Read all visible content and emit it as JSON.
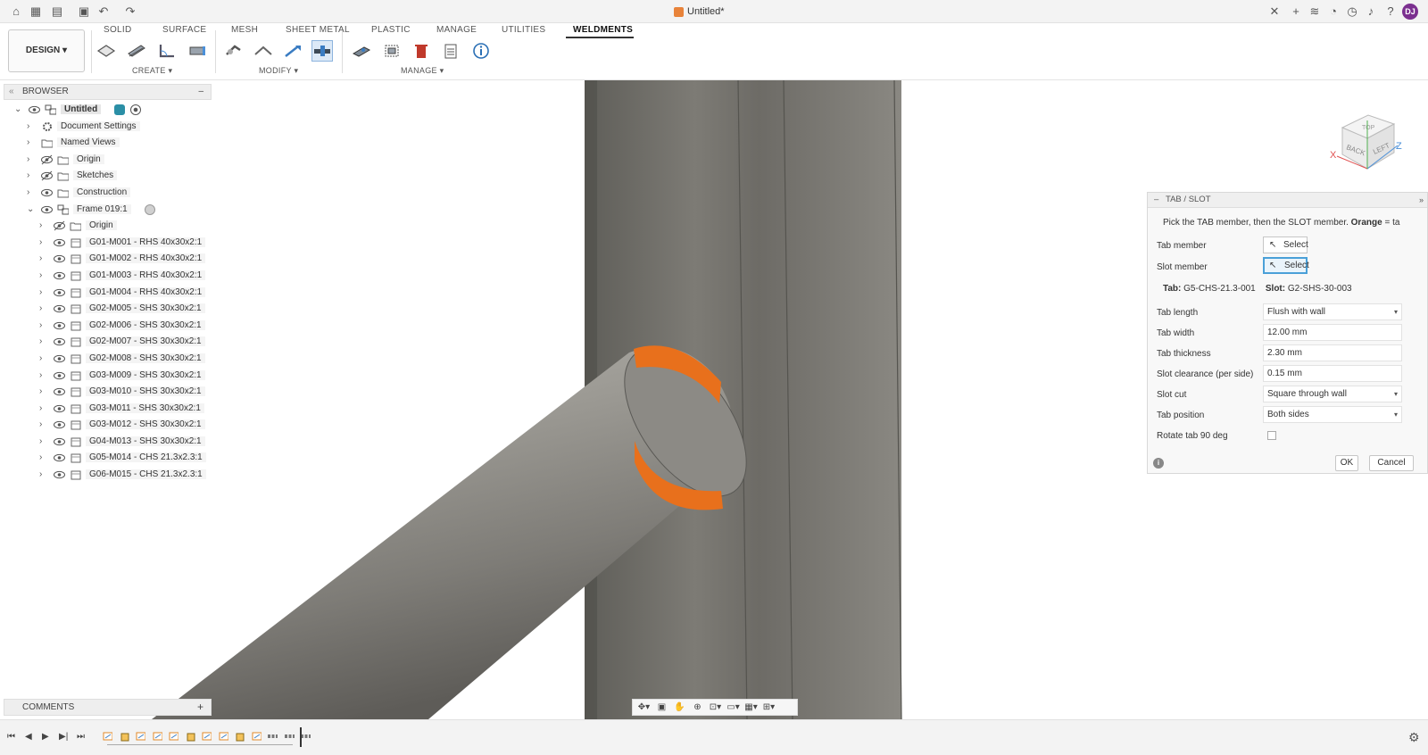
{
  "window": {
    "title": "Untitled*",
    "user_initials": "DJ"
  },
  "workspace_button": "DESIGN",
  "tabs": [
    {
      "label": "SOLID"
    },
    {
      "label": "SURFACE"
    },
    {
      "label": "MESH"
    },
    {
      "label": "SHEET METAL"
    },
    {
      "label": "PLASTIC"
    },
    {
      "label": "MANAGE"
    },
    {
      "label": "UTILITIES"
    },
    {
      "label": "WELDMENTS"
    }
  ],
  "active_tab": "WELDMENTS",
  "tool_groups": {
    "create": "CREATE",
    "modify": "MODIFY",
    "manage": "MANAGE"
  },
  "browser": {
    "title": "BROWSER",
    "root": "Untitled",
    "items": [
      {
        "label": "Document Settings"
      },
      {
        "label": "Named Views"
      },
      {
        "label": "Origin"
      },
      {
        "label": "Sketches"
      },
      {
        "label": "Construction"
      },
      {
        "label": "Frame 019:1"
      },
      {
        "label": "Origin"
      },
      {
        "label": "G01-M001 - RHS 40x30x2:1"
      },
      {
        "label": "G01-M002 - RHS 40x30x2:1"
      },
      {
        "label": "G01-M003 - RHS 40x30x2:1"
      },
      {
        "label": "G01-M004 - RHS 40x30x2:1"
      },
      {
        "label": "G02-M005 - SHS 30x30x2:1"
      },
      {
        "label": "G02-M006 - SHS 30x30x2:1"
      },
      {
        "label": "G02-M007 - SHS 30x30x2:1"
      },
      {
        "label": "G02-M008 - SHS 30x30x2:1"
      },
      {
        "label": "G03-M009 - SHS 30x30x2:1"
      },
      {
        "label": "G03-M010 - SHS 30x30x2:1"
      },
      {
        "label": "G03-M011 - SHS 30x30x2:1"
      },
      {
        "label": "G03-M012 - SHS 30x30x2:1"
      },
      {
        "label": "G04-M013 - SHS 30x30x2:1"
      },
      {
        "label": "G05-M014 - CHS 21.3x2.3:1"
      },
      {
        "label": "G06-M015 - CHS 21.3x2.3:1"
      }
    ]
  },
  "comments": {
    "title": "COMMENTS"
  },
  "viewcube": {
    "faces": [
      "TOP",
      "BACK",
      "LEFT"
    ],
    "axes": [
      "X",
      "Z"
    ]
  },
  "dialog": {
    "title": "TAB / SLOT",
    "message_a": "Pick the TAB member, then the SLOT member.",
    "message_b": "Orange",
    "message_c": "= ta",
    "tab_member_label": "Tab member",
    "slot_member_label": "Slot member",
    "select_label": "Select",
    "tab_key": "Tab:",
    "tab_value": "G5-CHS-21.3-001",
    "slot_key": "Slot:",
    "slot_value": "G2-SHS-30-003",
    "fields": [
      {
        "label": "Tab length",
        "value": "Flush with wall",
        "type": "dropdown"
      },
      {
        "label": "Tab width",
        "value": "12.00 mm",
        "type": "input"
      },
      {
        "label": "Tab thickness",
        "value": "2.30 mm",
        "type": "input"
      },
      {
        "label": "Slot clearance (per side)",
        "value": "0.15 mm",
        "type": "input"
      },
      {
        "label": "Slot cut",
        "value": "Square through wall",
        "type": "dropdown"
      },
      {
        "label": "Tab position",
        "value": "Both sides",
        "type": "dropdown"
      }
    ],
    "rotate_label": "Rotate tab 90 deg",
    "rotate_checked": false,
    "ok": "OK",
    "cancel": "Cancel"
  },
  "colors": {
    "accent": "#e8833a",
    "highlight": "#4aa0d8",
    "tube": "#8a8680",
    "post": "#7a7872"
  }
}
